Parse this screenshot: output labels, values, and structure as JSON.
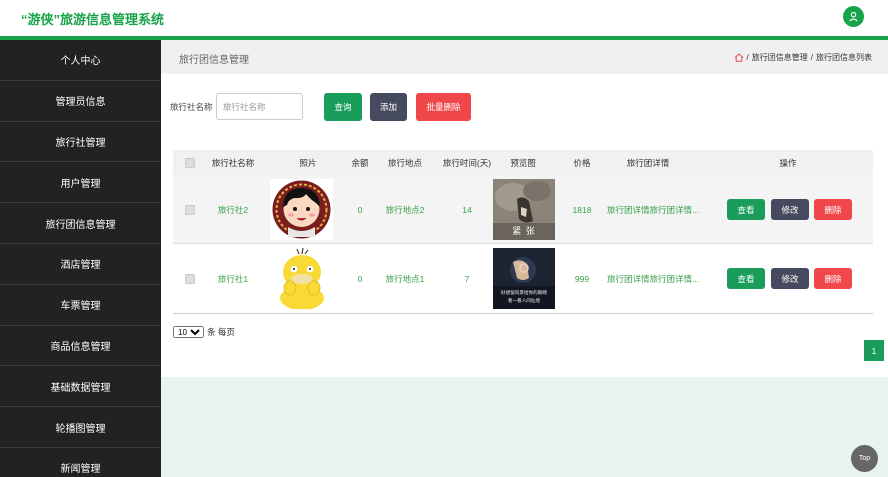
{
  "header": {
    "title": "“游侠”旅游信息管理系统"
  },
  "sidebar": {
    "items": [
      {
        "label": "个人中心"
      },
      {
        "label": "管理员信息"
      },
      {
        "label": "旅行社管理"
      },
      {
        "label": "用户管理"
      },
      {
        "label": "旅行团信息管理"
      },
      {
        "label": "酒店管理"
      },
      {
        "label": "车票管理"
      },
      {
        "label": "商品信息管理"
      },
      {
        "label": "基础数据管理"
      },
      {
        "label": "轮播图管理"
      },
      {
        "label": "新闻管理"
      }
    ]
  },
  "breadcrumb": {
    "page_title": "旅行团信息管理",
    "sep": "/",
    "level1": "旅行团信息管理",
    "level2": "旅行团信息列表"
  },
  "search": {
    "label": "旅行社名称",
    "value": "",
    "placeholder": "旅行社名称",
    "query_label": "查询",
    "add_label": "添加",
    "batch_delete_label": "批量删除"
  },
  "table": {
    "headers": [
      "旅行社名称",
      "照片",
      "余额",
      "旅行地点",
      "旅行时间(天)",
      "预览图",
      "价格",
      "旅行团详情",
      "操作"
    ],
    "rows": [
      {
        "agency": "旅行社2",
        "balance": "0",
        "location": "旅行地点2",
        "days": "14",
        "price": "1818",
        "detail": "旅行团详情旅行团详情...",
        "preview_caption": "紧 张"
      },
      {
        "agency": "旅行社1",
        "balance": "0",
        "location": "旅行地点1",
        "days": "7",
        "price": "999",
        "detail": "旅行团详情旅行团详情...",
        "preview_caption_line1": "好想留风景给你的眼睛",
        "preview_caption_line2": "看一看人间仙境"
      }
    ],
    "view_label": "查看",
    "edit_label": "修改",
    "delete_label": "删除"
  },
  "pager": {
    "page_size": "10",
    "suffix": "条 每页",
    "current_page": "1"
  },
  "back_to_top": "Top",
  "colors": {
    "accent": "#1aa34a",
    "sidebar_bg": "#222222",
    "danger": "#f0474a",
    "dark_button": "#454a5e"
  }
}
